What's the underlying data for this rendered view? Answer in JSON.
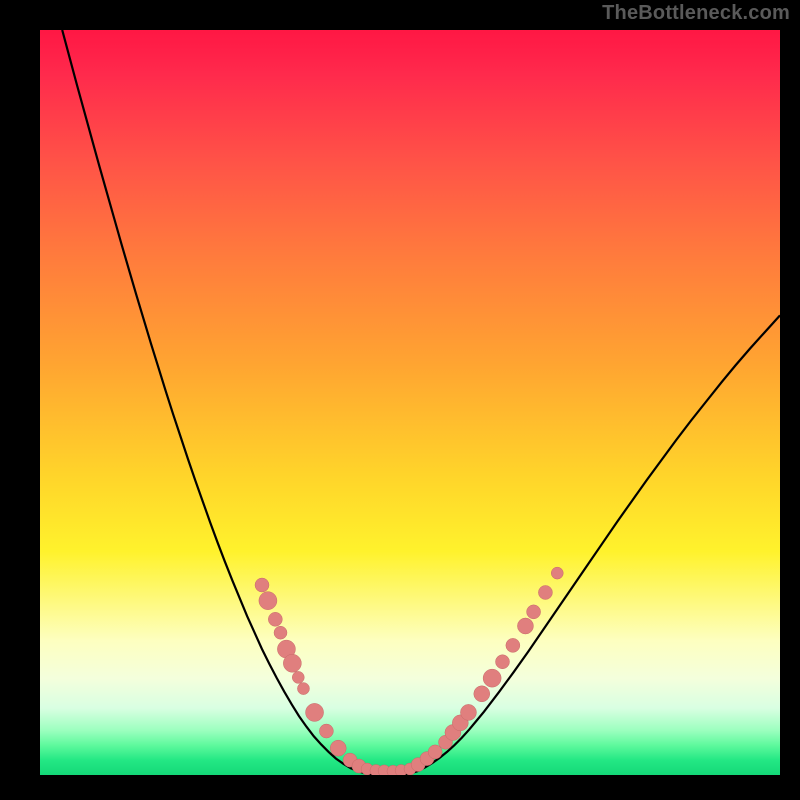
{
  "watermark": "TheBottleneck.com",
  "colors": {
    "frame": "#000000",
    "curve": "#000000",
    "marker_fill": "#e07f7e",
    "marker_stroke": "#c76a69",
    "gradient_stops": [
      "#ff1744",
      "#ff2a4c",
      "#ff5447",
      "#ff7a3d",
      "#ffa531",
      "#ffd52a",
      "#fff22c",
      "#fdffc0",
      "#f4ffdc",
      "#d9ffe2",
      "#9cffbf",
      "#5ef99d",
      "#24e884",
      "#14d878"
    ]
  },
  "chart_data": {
    "type": "line",
    "title": "",
    "xlabel": "",
    "ylabel": "",
    "xlim": [
      0,
      100
    ],
    "ylim": [
      0,
      100
    ],
    "x": [
      3,
      4,
      5,
      6,
      7,
      8,
      9,
      10,
      11,
      12,
      13,
      14,
      15,
      16,
      17,
      18,
      19,
      20,
      21,
      22,
      23,
      24,
      25,
      26,
      27,
      28,
      29,
      30,
      31,
      32,
      33,
      34,
      35,
      36,
      37,
      38,
      39,
      40,
      41,
      42,
      43,
      44,
      45,
      46,
      47,
      48,
      49,
      50,
      51,
      52,
      53,
      54,
      55,
      56,
      57,
      58,
      59,
      60,
      62,
      64,
      66,
      68,
      70,
      72,
      74,
      76,
      78,
      80,
      82,
      84,
      86,
      88,
      90,
      92,
      94,
      96,
      98,
      100
    ],
    "y": [
      100,
      96.3,
      92.6,
      89,
      85.4,
      81.8,
      78.3,
      74.8,
      71.3,
      67.9,
      64.5,
      61.2,
      57.9,
      54.7,
      51.5,
      48.4,
      45.4,
      42.4,
      39.5,
      36.7,
      33.9,
      31.2,
      28.6,
      26.1,
      23.7,
      21.3,
      19.1,
      16.9,
      14.9,
      13,
      11.2,
      9.5,
      7.9,
      6.5,
      5.2,
      4.1,
      3.1,
      2.2,
      1.5,
      0.9,
      0.5,
      0.2,
      0.1,
      0,
      0,
      0,
      0.1,
      0.2,
      0.5,
      1,
      1.6,
      2.3,
      3.1,
      4,
      5,
      6.1,
      7.3,
      8.5,
      11.1,
      13.8,
      16.6,
      19.5,
      22.4,
      25.3,
      28.2,
      31.1,
      34,
      36.8,
      39.6,
      42.3,
      45,
      47.6,
      50.1,
      52.6,
      55,
      57.3,
      59.5,
      61.7
    ],
    "markers": [
      {
        "x": 30,
        "y": 25.5,
        "r": 7
      },
      {
        "x": 30.8,
        "y": 23.4,
        "r": 9
      },
      {
        "x": 31.8,
        "y": 20.9,
        "r": 7
      },
      {
        "x": 32.5,
        "y": 19.1,
        "r": 6.5
      },
      {
        "x": 33.3,
        "y": 16.9,
        "r": 9
      },
      {
        "x": 34.1,
        "y": 15,
        "r": 9
      },
      {
        "x": 34.9,
        "y": 13.1,
        "r": 6
      },
      {
        "x": 35.6,
        "y": 11.6,
        "r": 6
      },
      {
        "x": 37.1,
        "y": 8.4,
        "r": 9
      },
      {
        "x": 38.7,
        "y": 5.9,
        "r": 7
      },
      {
        "x": 40.3,
        "y": 3.6,
        "r": 8
      },
      {
        "x": 41.9,
        "y": 2,
        "r": 7
      },
      {
        "x": 43.1,
        "y": 1.2,
        "r": 7
      },
      {
        "x": 44.2,
        "y": 0.8,
        "r": 6
      },
      {
        "x": 45.4,
        "y": 0.6,
        "r": 6
      },
      {
        "x": 46.5,
        "y": 0.55,
        "r": 6
      },
      {
        "x": 47.7,
        "y": 0.5,
        "r": 6
      },
      {
        "x": 48.8,
        "y": 0.6,
        "r": 6
      },
      {
        "x": 50,
        "y": 0.8,
        "r": 6
      },
      {
        "x": 51.1,
        "y": 1.4,
        "r": 7
      },
      {
        "x": 52.3,
        "y": 2.2,
        "r": 7
      },
      {
        "x": 53.4,
        "y": 3.1,
        "r": 7
      },
      {
        "x": 54.8,
        "y": 4.4,
        "r": 7
      },
      {
        "x": 55.8,
        "y": 5.7,
        "r": 8
      },
      {
        "x": 56.8,
        "y": 7,
        "r": 8
      },
      {
        "x": 57.9,
        "y": 8.4,
        "r": 8
      },
      {
        "x": 59.7,
        "y": 10.9,
        "r": 8
      },
      {
        "x": 61.1,
        "y": 13,
        "r": 9
      },
      {
        "x": 62.5,
        "y": 15.2,
        "r": 7
      },
      {
        "x": 63.9,
        "y": 17.4,
        "r": 7
      },
      {
        "x": 65.6,
        "y": 20,
        "r": 8
      },
      {
        "x": 66.7,
        "y": 21.9,
        "r": 7
      },
      {
        "x": 68.3,
        "y": 24.5,
        "r": 7
      },
      {
        "x": 69.9,
        "y": 27.1,
        "r": 6
      }
    ]
  }
}
